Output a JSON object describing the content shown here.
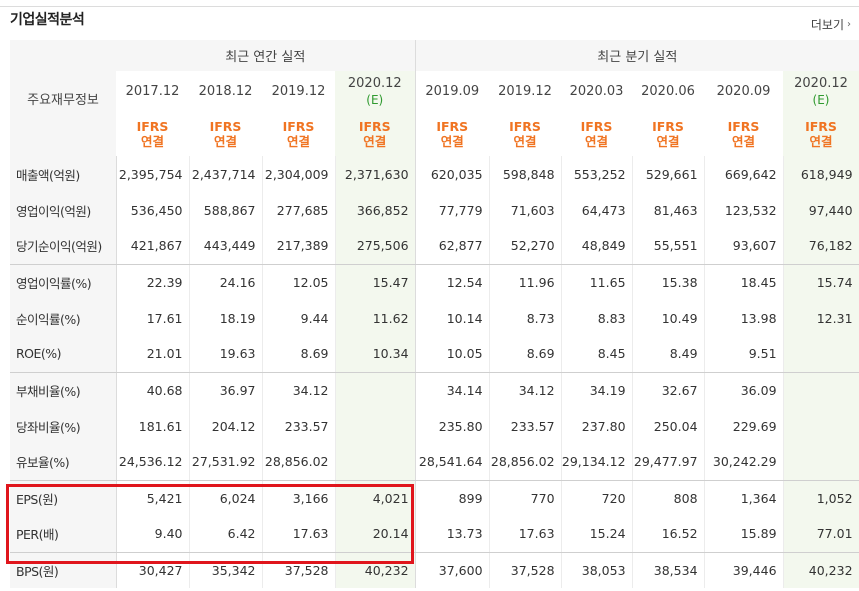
{
  "header": {
    "title": "기업실적분석",
    "more_label": "더보기",
    "more_icon": "chevron-right-icon"
  },
  "table": {
    "row_header_title": "주요재무정보",
    "group_annual": "최근 연간 실적",
    "group_quarter": "최근 분기 실적",
    "periods": [
      {
        "label": "2017.12",
        "est": ""
      },
      {
        "label": "2018.12",
        "est": ""
      },
      {
        "label": "2019.12",
        "est": ""
      },
      {
        "label": "2020.12",
        "est": "(E)"
      },
      {
        "label": "2019.09",
        "est": ""
      },
      {
        "label": "2019.12",
        "est": ""
      },
      {
        "label": "2020.03",
        "est": ""
      },
      {
        "label": "2020.06",
        "est": ""
      },
      {
        "label": "2020.09",
        "est": ""
      },
      {
        "label": "2020.12",
        "est": "(E)"
      }
    ],
    "basis_top": "IFRS",
    "basis_bottom": "연결",
    "rows": [
      {
        "label": "매출액(억원)",
        "values": [
          "2,395,754",
          "2,437,714",
          "2,304,009",
          "2,371,630",
          "620,035",
          "598,848",
          "553,252",
          "529,661",
          "669,642",
          "618,949"
        ]
      },
      {
        "label": "영업이익(억원)",
        "values": [
          "536,450",
          "588,867",
          "277,685",
          "366,852",
          "77,779",
          "71,603",
          "64,473",
          "81,463",
          "123,532",
          "97,440"
        ]
      },
      {
        "label": "당기순이익(억원)",
        "values": [
          "421,867",
          "443,449",
          "217,389",
          "275,506",
          "62,877",
          "52,270",
          "48,849",
          "55,551",
          "93,607",
          "76,182"
        ]
      },
      {
        "label": "영업이익률(%)",
        "values": [
          "22.39",
          "24.16",
          "12.05",
          "15.47",
          "12.54",
          "11.96",
          "11.65",
          "15.38",
          "18.45",
          "15.74"
        ]
      },
      {
        "label": "순이익률(%)",
        "values": [
          "17.61",
          "18.19",
          "9.44",
          "11.62",
          "10.14",
          "8.73",
          "8.83",
          "10.49",
          "13.98",
          "12.31"
        ]
      },
      {
        "label": "ROE(%)",
        "values": [
          "21.01",
          "19.63",
          "8.69",
          "10.34",
          "10.05",
          "8.69",
          "8.45",
          "8.49",
          "9.51",
          ""
        ]
      },
      {
        "label": "부채비율(%)",
        "values": [
          "40.68",
          "36.97",
          "34.12",
          "",
          "34.14",
          "34.12",
          "34.19",
          "32.67",
          "36.09",
          ""
        ]
      },
      {
        "label": "당좌비율(%)",
        "values": [
          "181.61",
          "204.12",
          "233.57",
          "",
          "235.80",
          "233.57",
          "237.80",
          "250.04",
          "229.69",
          ""
        ]
      },
      {
        "label": "유보율(%)",
        "values": [
          "24,536.12",
          "27,531.92",
          "28,856.02",
          "",
          "28,541.64",
          "28,856.02",
          "29,134.12",
          "29,477.97",
          "30,242.29",
          ""
        ]
      },
      {
        "label": "EPS(원)",
        "values": [
          "5,421",
          "6,024",
          "3,166",
          "4,021",
          "899",
          "770",
          "720",
          "808",
          "1,364",
          "1,052"
        ]
      },
      {
        "label": "PER(배)",
        "values": [
          "9.40",
          "6.42",
          "17.63",
          "20.14",
          "13.73",
          "17.63",
          "15.24",
          "16.52",
          "15.89",
          "77.01"
        ]
      },
      {
        "label": "BPS(원)",
        "values": [
          "30,427",
          "35,342",
          "37,528",
          "40,232",
          "37,600",
          "37,528",
          "38,053",
          "38,534",
          "39,446",
          "40,232"
        ]
      }
    ]
  },
  "highlight": {
    "color": "#e0151c",
    "covers_rows": [
      "EPS(원)",
      "PER(배)"
    ]
  }
}
